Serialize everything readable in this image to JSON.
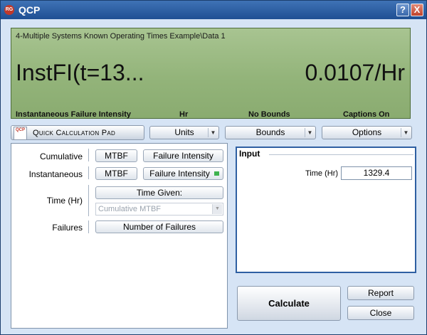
{
  "window": {
    "title": "QCP",
    "icon_text": "RG",
    "help_label": "?",
    "close_label": "X"
  },
  "display": {
    "path": "4-Multiple Systems Known Operating Times Example\\Data 1",
    "name": "InstFI(t=13...",
    "value": "0.0107/Hr",
    "captions": {
      "metric": "Instantaneous Failure Intensity",
      "units": "Hr",
      "bounds": "No Bounds",
      "captions_state": "Captions On"
    }
  },
  "toolbar": {
    "qcp_logo": "QCP",
    "qcp_label": "Quick Calculation Pad",
    "dropdowns": [
      {
        "label": "Units"
      },
      {
        "label": "Bounds"
      },
      {
        "label": "Options"
      }
    ]
  },
  "calc_options": {
    "cumulative": {
      "label": "Cumulative",
      "mtbf": "MTBF",
      "fi": "Failure Intensity"
    },
    "instantaneous": {
      "label": "Instantaneous",
      "mtbf": "MTBF",
      "fi": "Failure Intensity"
    },
    "time": {
      "label": "Time (Hr)",
      "button": "Time Given:",
      "select_value": "Cumulative MTBF"
    },
    "failures": {
      "label": "Failures",
      "button": "Number of Failures"
    }
  },
  "input": {
    "title": "Input",
    "time_label": "Time (Hr)",
    "time_value": "1329.4"
  },
  "actions": {
    "calculate": "Calculate",
    "report": "Report",
    "close": "Close"
  },
  "colors": {
    "display_bg": "#93b47a",
    "titlebar": "#2a5ea2",
    "active_indicator": "#3fb34f"
  }
}
